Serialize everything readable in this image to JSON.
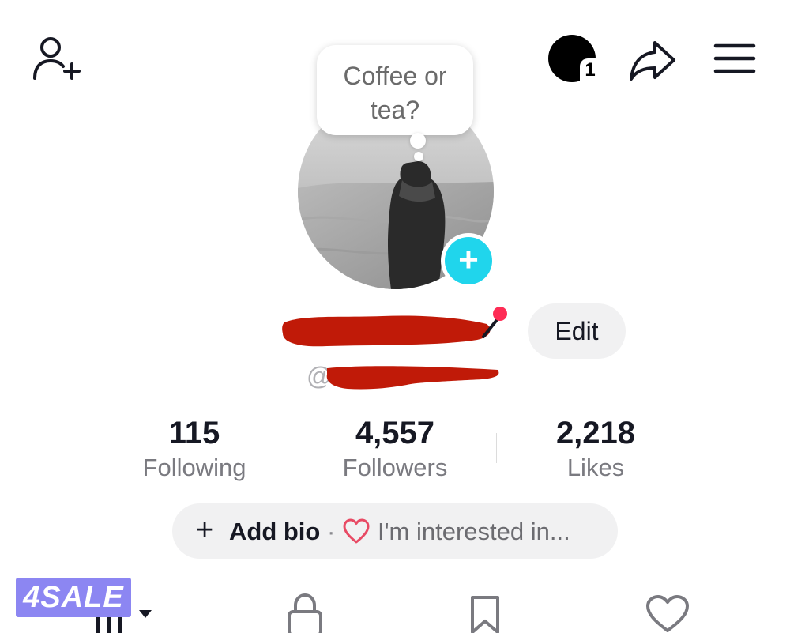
{
  "header": {
    "add_friend_icon": "person-add-icon",
    "notification_count": "1",
    "share_icon": "share-arrow-icon",
    "menu_icon": "hamburger-menu-icon"
  },
  "profile": {
    "note_bubble": "Coffee or tea?",
    "add_button_icon": "plus-icon",
    "edit_label": "Edit",
    "username_prefix": "@"
  },
  "stats": [
    {
      "value": "115",
      "label": "Following"
    },
    {
      "value": "4,557",
      "label": "Followers"
    },
    {
      "value": "2,218",
      "label": "Likes"
    }
  ],
  "bio": {
    "plus": "+",
    "add_bio_label": "Add bio",
    "separator": "·",
    "interest_text": "I'm interested in..."
  },
  "tabs": [
    {
      "icon": "videos-grid-icon"
    },
    {
      "icon": "lock-icon"
    },
    {
      "icon": "bookmark-icon"
    },
    {
      "icon": "heart-icon"
    }
  ],
  "watermark": {
    "text": "4SALE"
  },
  "colors": {
    "accent_blue": "#20d5ec",
    "notification_red": "#fe2c55",
    "redaction_red": "#c01a08",
    "pill_gray": "#f1f1f2",
    "watermark_purple": "#8c86f2"
  }
}
